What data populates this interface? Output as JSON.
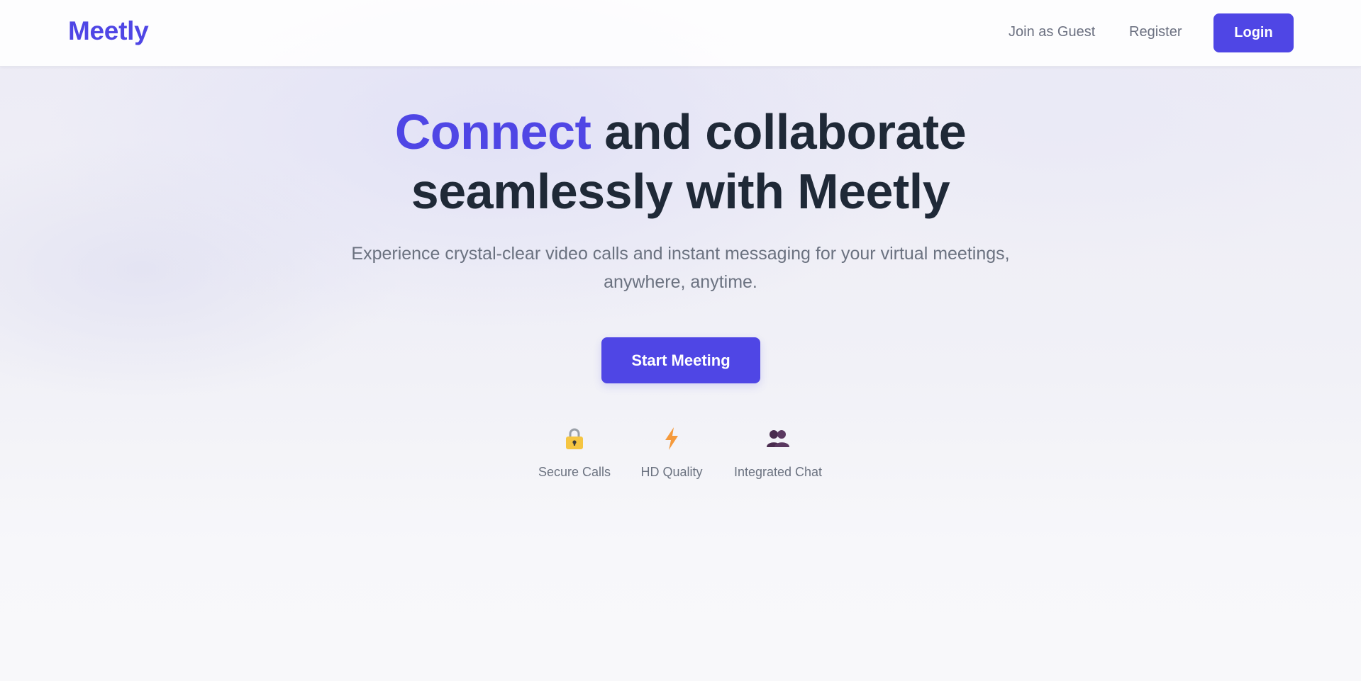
{
  "header": {
    "logo": "Meetly",
    "nav": {
      "join_guest": "Join as Guest",
      "register": "Register",
      "login": "Login"
    }
  },
  "hero": {
    "title_accent": "Connect",
    "title_rest_line1": " and collaborate",
    "title_line2": "seamlessly with Meetly",
    "subtitle_line1": "Experience crystal-clear video calls and instant messaging for your virtual meetings,",
    "subtitle_line2": "anywhere, anytime.",
    "cta_label": "Start Meeting"
  },
  "features": [
    {
      "icon": "lock-icon",
      "label": "Secure Calls"
    },
    {
      "icon": "lightning-icon",
      "label": "HD Quality"
    },
    {
      "icon": "people-icon",
      "label": "Integrated Chat"
    }
  ],
  "colors": {
    "brand": "#4f46e5",
    "heading": "#1f2937",
    "muted": "#6b7280",
    "lock": "#f5c542",
    "lightning": "#f59a3c",
    "people": "#4a2c4f"
  }
}
